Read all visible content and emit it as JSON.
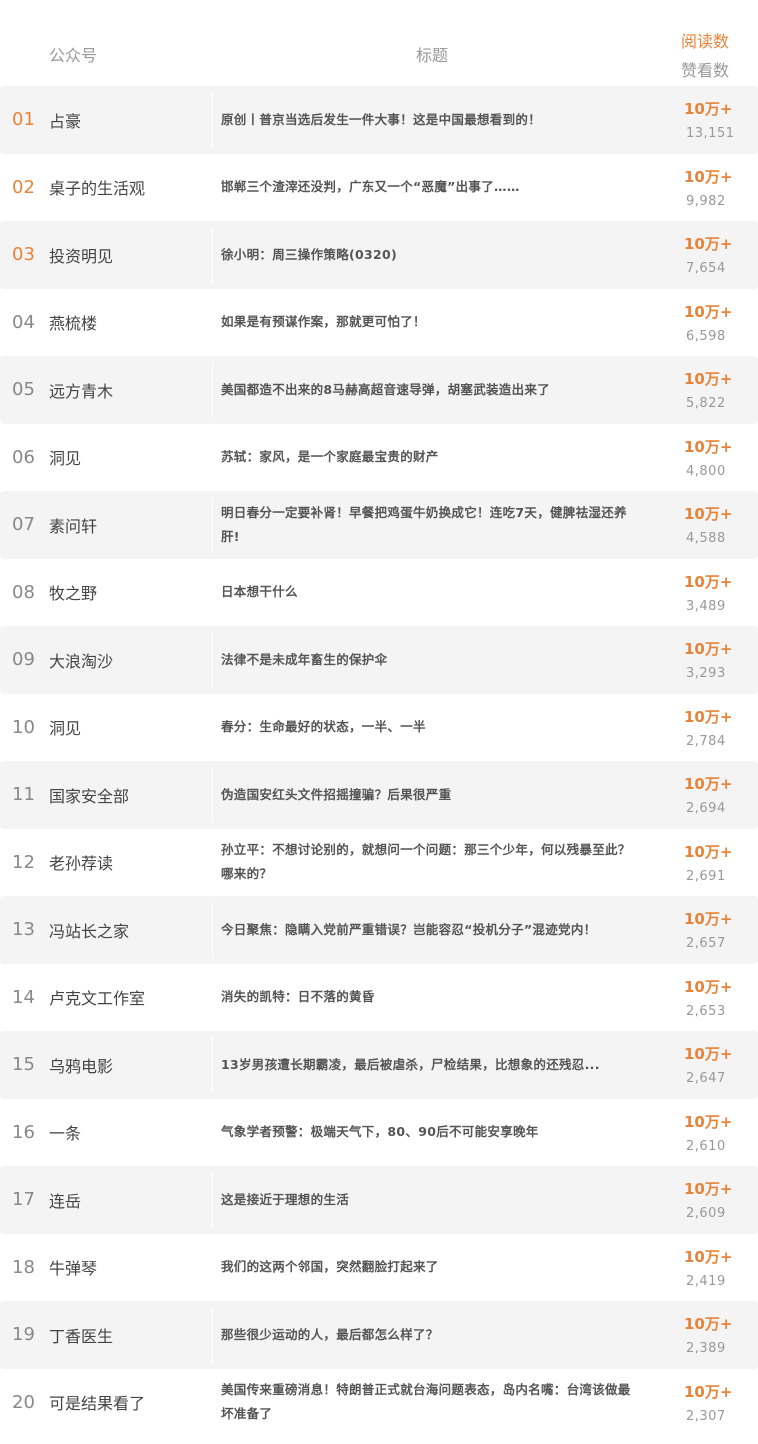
{
  "header": {
    "account_label": "公众号",
    "title_label": "标题",
    "reads_label": "阅读数",
    "likes_label": "赞看数"
  },
  "colors": {
    "accent": "#e8833a",
    "row_alt_bg": "#f4f4f4",
    "muted_text": "#999999"
  },
  "rows": [
    {
      "rank": "01",
      "account": "占豪",
      "title": "原创丨普京当选后发生一件大事！这是中国最想看到的！",
      "reads": "10万+",
      "likes": "13,151"
    },
    {
      "rank": "02",
      "account": "桌子的生活观",
      "title": "邯郸三个渣滓还没判，广东又一个“恶魔”出事了……",
      "reads": "10万+",
      "likes": "9,982"
    },
    {
      "rank": "03",
      "account": "投资明见",
      "title": "徐小明：周三操作策略(0320)",
      "reads": "10万+",
      "likes": "7,654"
    },
    {
      "rank": "04",
      "account": "燕梳楼",
      "title": "如果是有预谋作案，那就更可怕了！",
      "reads": "10万+",
      "likes": "6,598"
    },
    {
      "rank": "05",
      "account": "远方青木",
      "title": "美国都造不出来的8马赫高超音速导弹，胡塞武装造出来了",
      "reads": "10万+",
      "likes": "5,822"
    },
    {
      "rank": "06",
      "account": "洞见",
      "title": "苏轼：家风，是一个家庭最宝贵的财产",
      "reads": "10万+",
      "likes": "4,800"
    },
    {
      "rank": "07",
      "account": "素问轩",
      "title": "明日春分一定要补肾！早餐把鸡蛋牛奶换成它！连吃7天，健脾祛湿还养肝!",
      "reads": "10万+",
      "likes": "4,588"
    },
    {
      "rank": "08",
      "account": "牧之野",
      "title": "日本想干什么",
      "reads": "10万+",
      "likes": "3,489"
    },
    {
      "rank": "09",
      "account": "大浪淘沙",
      "title": "法律不是未成年畜生的保护伞",
      "reads": "10万+",
      "likes": "3,293"
    },
    {
      "rank": "10",
      "account": "洞见",
      "title": "春分：生命最好的状态，一半、一半",
      "reads": "10万+",
      "likes": "2,784"
    },
    {
      "rank": "11",
      "account": "国家安全部",
      "title": "伪造国安红头文件招摇撞骗？后果很严重",
      "reads": "10万+",
      "likes": "2,694"
    },
    {
      "rank": "12",
      "account": "老孙荐读",
      "title": "孙立平：不想讨论别的，就想问一个问题：那三个少年，何以残暴至此？哪来的？",
      "reads": "10万+",
      "likes": "2,691"
    },
    {
      "rank": "13",
      "account": "冯站长之家",
      "title": "今日聚焦：隐瞒入党前严重错误？岂能容忍“投机分子”混迹党内！",
      "reads": "10万+",
      "likes": "2,657"
    },
    {
      "rank": "14",
      "account": "卢克文工作室",
      "title": "消失的凯特：日不落的黄昏",
      "reads": "10万+",
      "likes": "2,653"
    },
    {
      "rank": "15",
      "account": "乌鸦电影",
      "title": "13岁男孩遭长期霸凌，最后被虐杀，尸检结果，比想象的还残忍...",
      "reads": "10万+",
      "likes": "2,647"
    },
    {
      "rank": "16",
      "account": "一条",
      "title": "气象学者预警：极端天气下，80、90后不可能安享晚年",
      "reads": "10万+",
      "likes": "2,610"
    },
    {
      "rank": "17",
      "account": "连岳",
      "title": "这是接近于理想的生活",
      "reads": "10万+",
      "likes": "2,609"
    },
    {
      "rank": "18",
      "account": "牛弹琴",
      "title": "我们的这两个邻国，突然翻脸打起来了",
      "reads": "10万+",
      "likes": "2,419"
    },
    {
      "rank": "19",
      "account": "丁香医生",
      "title": "那些很少运动的人，最后都怎么样了？",
      "reads": "10万+",
      "likes": "2,389"
    },
    {
      "rank": "20",
      "account": "可是结果看了",
      "title": "美国传来重磅消息！特朗普正式就台海问题表态，岛内名嘴：台湾该做最坏准备了",
      "reads": "10万+",
      "likes": "2,307"
    }
  ]
}
